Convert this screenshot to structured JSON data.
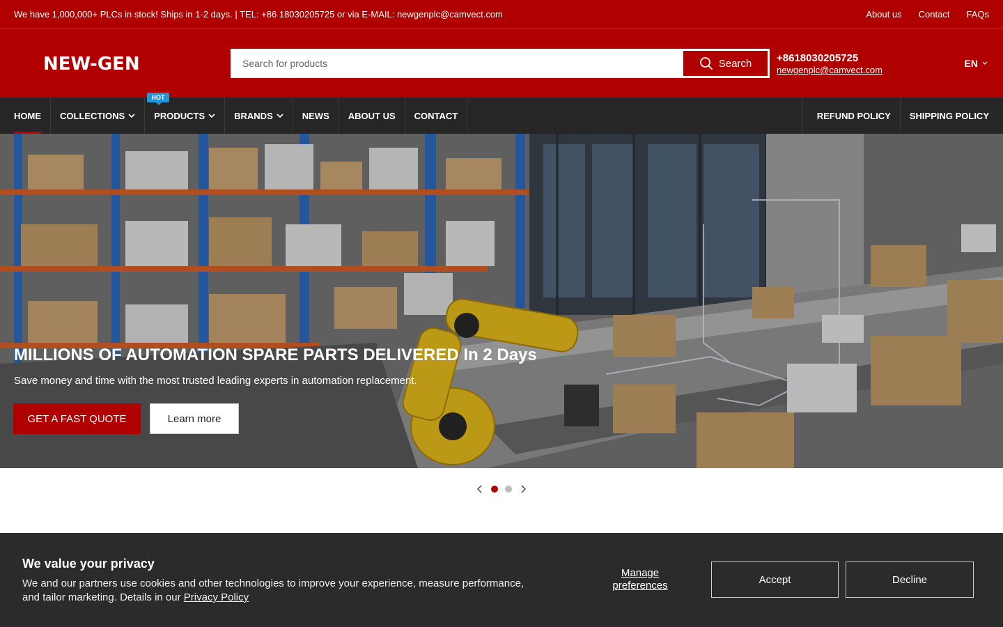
{
  "topbar": {
    "message": "We have 1,000,000+ PLCs in stock! Ships in 1-2 days. | TEL: +86 18030205725 or via E-MAIL: newgenplc@camvect.com",
    "links": [
      "About us",
      "Contact",
      "FAQs"
    ]
  },
  "header": {
    "logo": "NEW-GEN",
    "search_placeholder": "Search for products",
    "search_button": "Search",
    "phone": "+8618030205725",
    "email": "newgenplc@camvect.com",
    "language": "EN"
  },
  "nav": {
    "left": [
      {
        "label": "HOME",
        "active": true
      },
      {
        "label": "COLLECTIONS",
        "dropdown": true
      },
      {
        "label": "PRODUCTS",
        "dropdown": true,
        "badge": "HOT"
      },
      {
        "label": "BRANDS",
        "dropdown": true
      },
      {
        "label": "NEWS"
      },
      {
        "label": "ABOUT US"
      },
      {
        "label": "CONTACT"
      }
    ],
    "right": [
      "REFUND POLICY",
      "SHIPPING POLICY"
    ],
    "hot_badge": "HOT"
  },
  "hero": {
    "title": "MILLIONS OF AUTOMATION SPARE PARTS DELIVERED In 2 Days",
    "subtitle": "Save money and time with the most trusted leading experts in automation replacement.",
    "primary_button": "GET A FAST QUOTE",
    "secondary_button": "Learn more"
  },
  "slider": {
    "slides": 2,
    "active_index": 0
  },
  "cookie": {
    "title": "We value your privacy",
    "text": "We and our partners use cookies and other technologies to improve your experience, measure performance, and tailor marketing. Details in our",
    "policy_link": "Privacy Policy",
    "manage": "Manage preferences",
    "accept": "Accept",
    "decline": "Decline"
  },
  "colors": {
    "brand_red": "#b00000",
    "nav_bg": "#262626",
    "badge_blue": "#2196d9",
    "cookie_bg": "#2b2b2b"
  }
}
